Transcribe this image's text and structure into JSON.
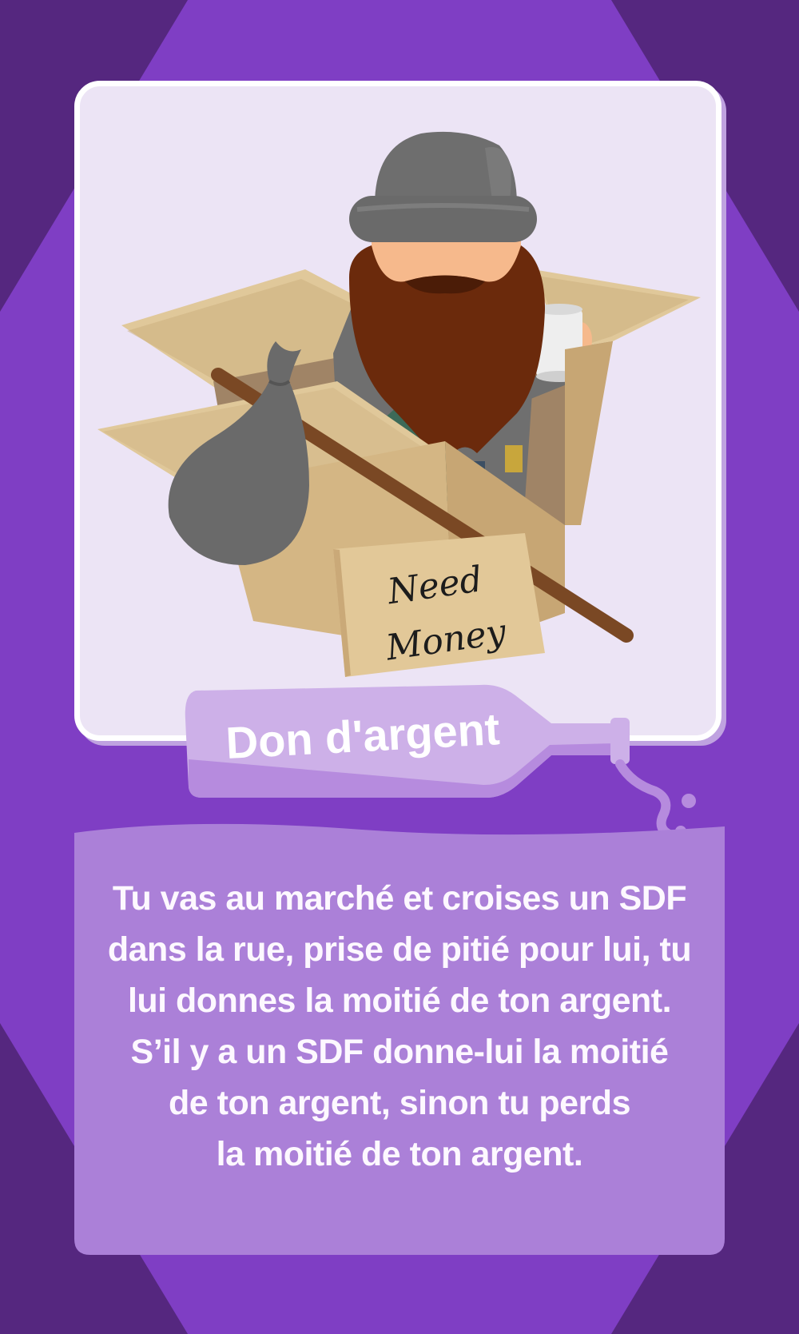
{
  "card": {
    "title": "Don d'argent",
    "sign_lines": [
      "Need",
      "Money"
    ],
    "description_lines": [
      "Tu vas au marché et croises un SDF",
      "dans la rue, prise de pitié pour lui, tu",
      "lui donnes la moitié de ton argent.",
      "S’il y a un SDF donne-lui la moitié",
      "de ton argent, sinon tu perds",
      "la moitié de ton argent."
    ]
  },
  "colors": {
    "outer_background": "#55277f",
    "octagon": "#7f3ec4",
    "panel_background": "#ece4f5",
    "bottle": "#cdb0e8",
    "description_box": "#ab80d8",
    "text": "#fdf8ff"
  },
  "icons": {
    "illustration": "homeless-man-in-cardboard-box-icon",
    "title_banner": "tipping-bottle-icon"
  }
}
